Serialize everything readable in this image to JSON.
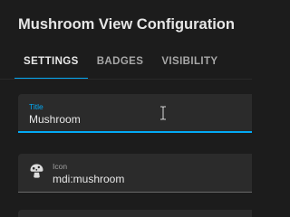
{
  "dialog": {
    "title": "Mushroom View Configuration"
  },
  "tabs": [
    {
      "label": "SETTINGS",
      "active": true
    },
    {
      "label": "BADGES",
      "active": false
    },
    {
      "label": "VISIBILITY",
      "active": false
    }
  ],
  "fields": {
    "title": {
      "label": "Title",
      "value": "Mushroom"
    },
    "icon": {
      "label": "Icon",
      "value": "mdi:mushroom",
      "icon": "mushroom-icon"
    }
  },
  "colors": {
    "accent": "#03a9f4",
    "background": "#1c1c1c",
    "field_background": "#2b2b2b"
  }
}
